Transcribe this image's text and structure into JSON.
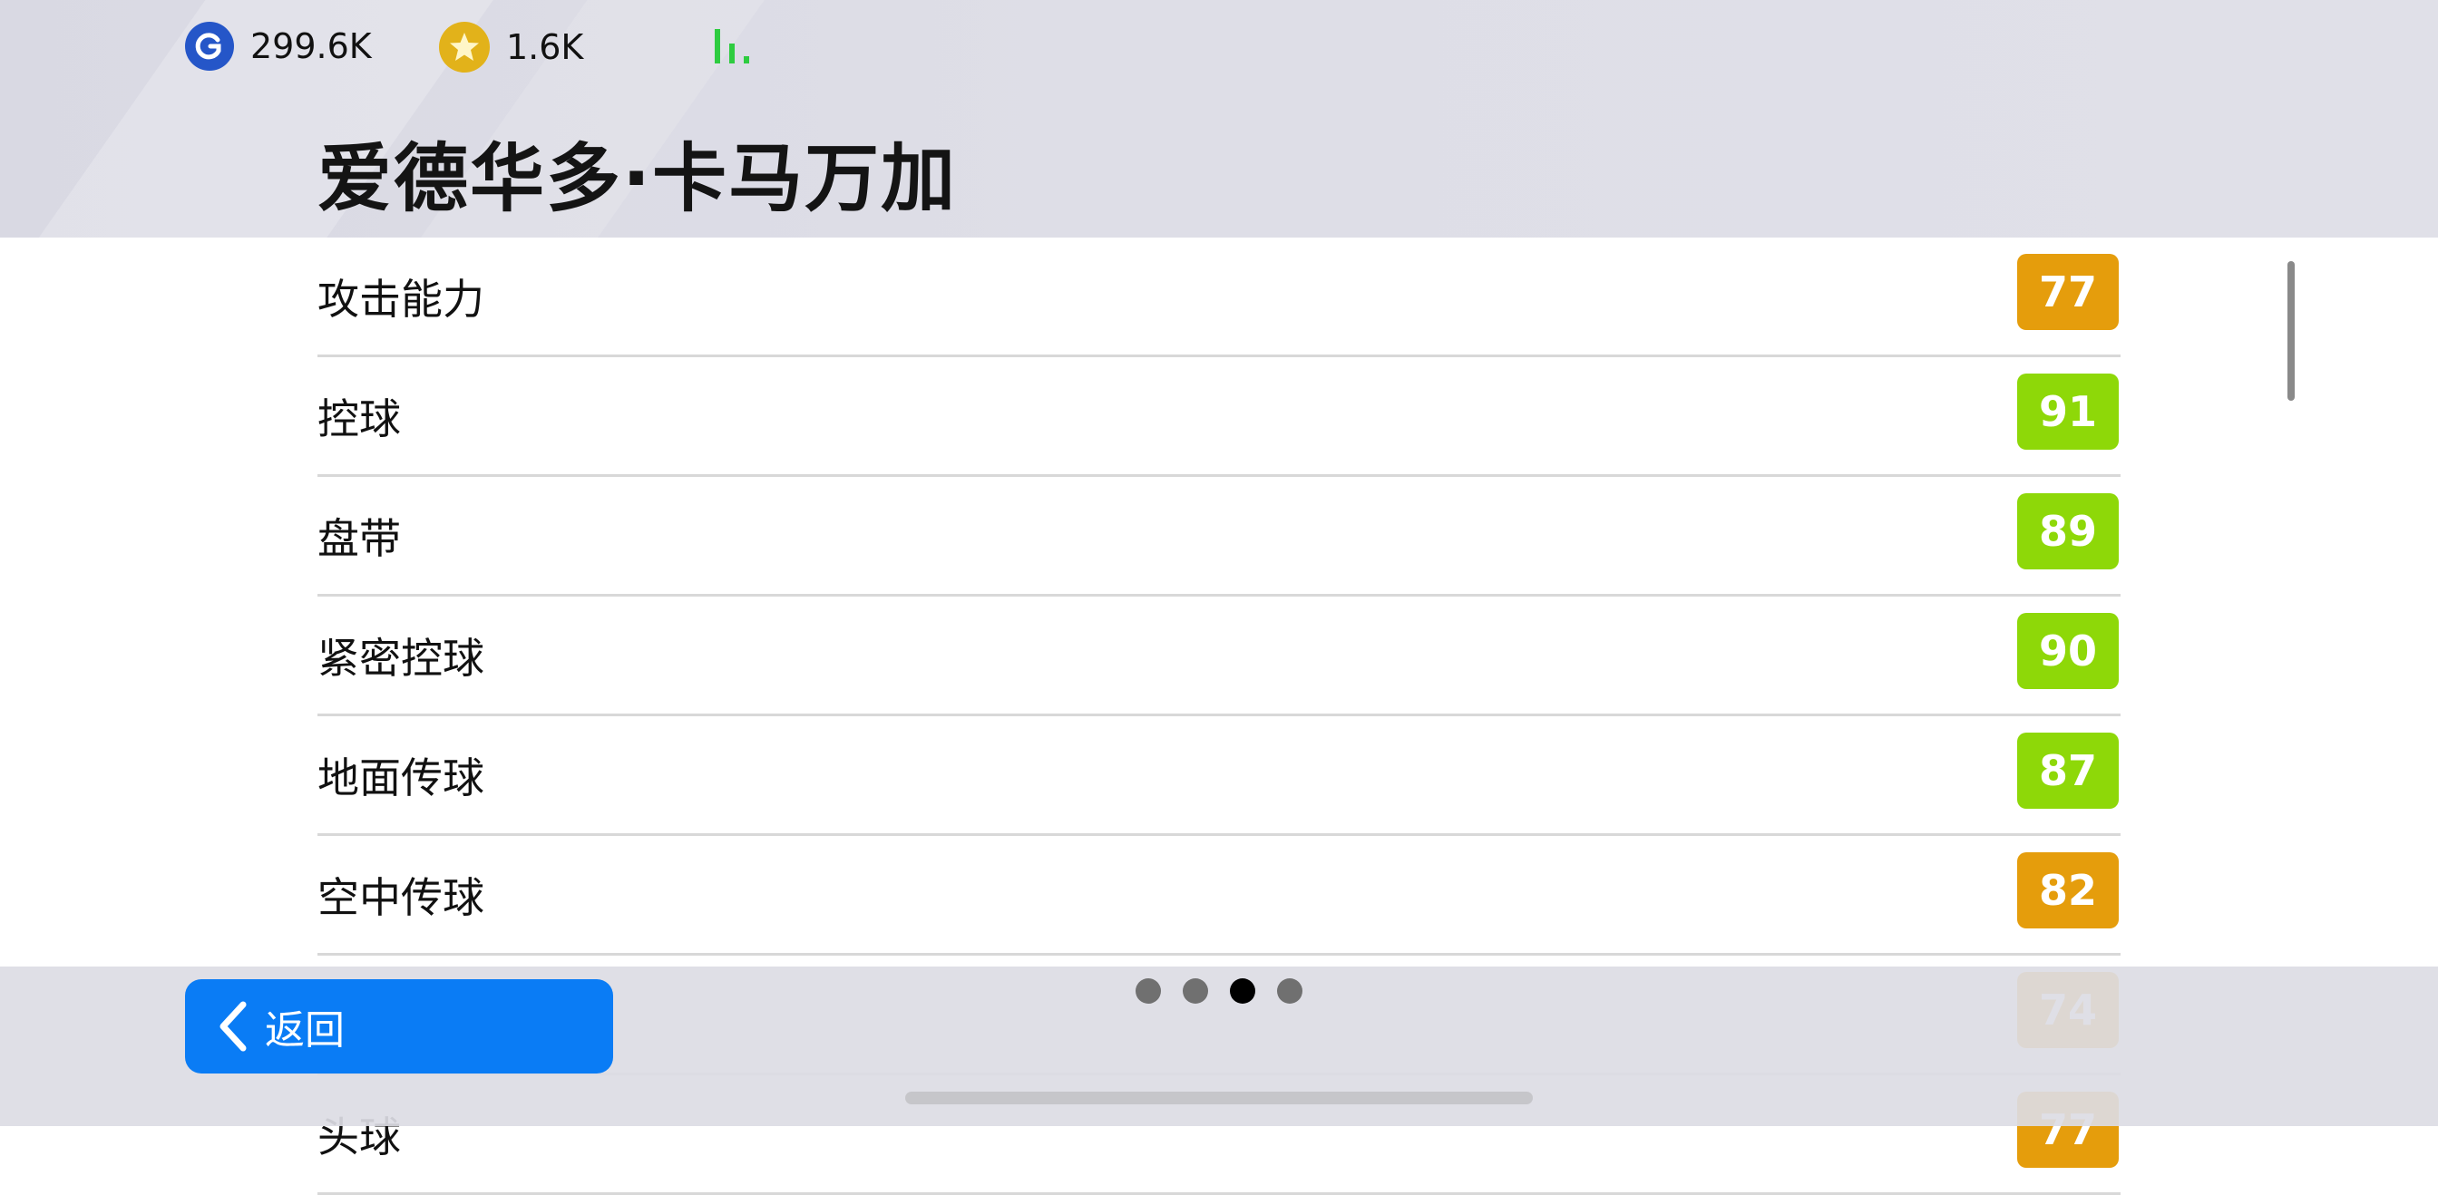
{
  "status_bar": {
    "gp_value": "299.6K",
    "coin_value": "1.6K",
    "gp_icon": "g-icon",
    "coin_icon": "star-coin-icon",
    "signal_icon": "signal-icon",
    "signal_color": "#2ecc40"
  },
  "player": {
    "name": "爱德华多·卡马万加"
  },
  "stats": [
    {
      "label": "攻击能力",
      "value": "77",
      "color": "orange"
    },
    {
      "label": "控球",
      "value": "91",
      "color": "green"
    },
    {
      "label": "盘带",
      "value": "89",
      "color": "green"
    },
    {
      "label": "紧密控球",
      "value": "90",
      "color": "green"
    },
    {
      "label": "地面传球",
      "value": "87",
      "color": "green"
    },
    {
      "label": "空中传球",
      "value": "82",
      "color": "orange"
    },
    {
      "label": "",
      "value": "74",
      "color": "orange"
    },
    {
      "label": "头球",
      "value": "77",
      "color": "orange"
    }
  ],
  "footer": {
    "back_label": "返回",
    "page_count": 4,
    "current_page": 3
  },
  "colors": {
    "accent_blue": "#0a7cf5",
    "badge_orange": "#e59d0c",
    "badge_green": "#8ed808"
  }
}
